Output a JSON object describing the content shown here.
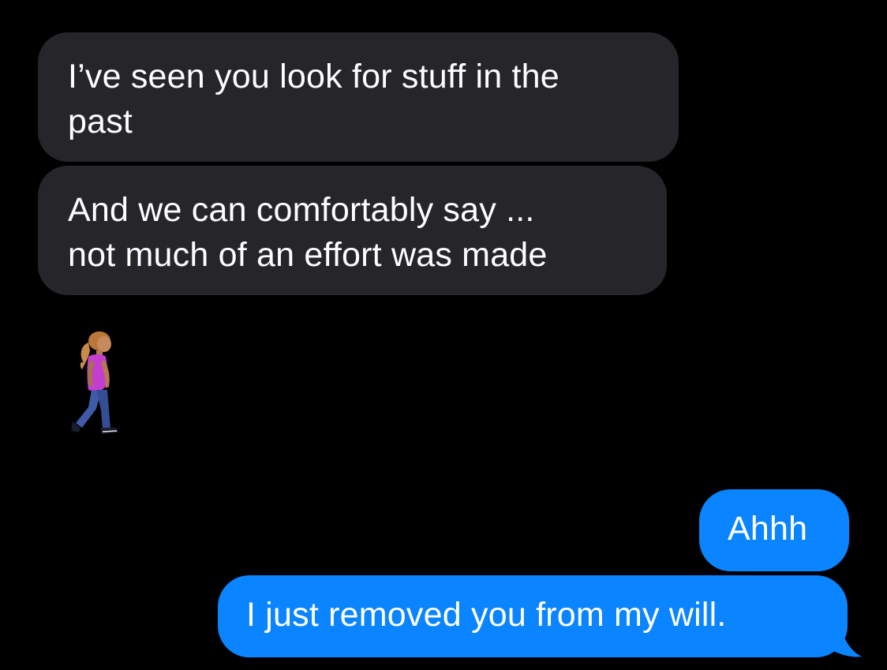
{
  "conversation": {
    "messages": [
      {
        "sender": "received",
        "lines": [
          "I’ve seen you look for stuff in the",
          "past"
        ]
      },
      {
        "sender": "received",
        "lines": [
          "And we can comfortably say ...",
          "not much of an effort was made"
        ]
      },
      {
        "sender": "received",
        "emoji": "woman-walking-emoji"
      },
      {
        "sender": "sent",
        "lines": [
          "Ahhh"
        ]
      },
      {
        "sender": "sent",
        "lines": [
          "I just removed you from my will."
        ]
      }
    ]
  },
  "colors": {
    "background": "#000000",
    "received_bubble": "#26252A",
    "sent_bubble": "#0A84FF",
    "text": "#FFFFFF"
  }
}
